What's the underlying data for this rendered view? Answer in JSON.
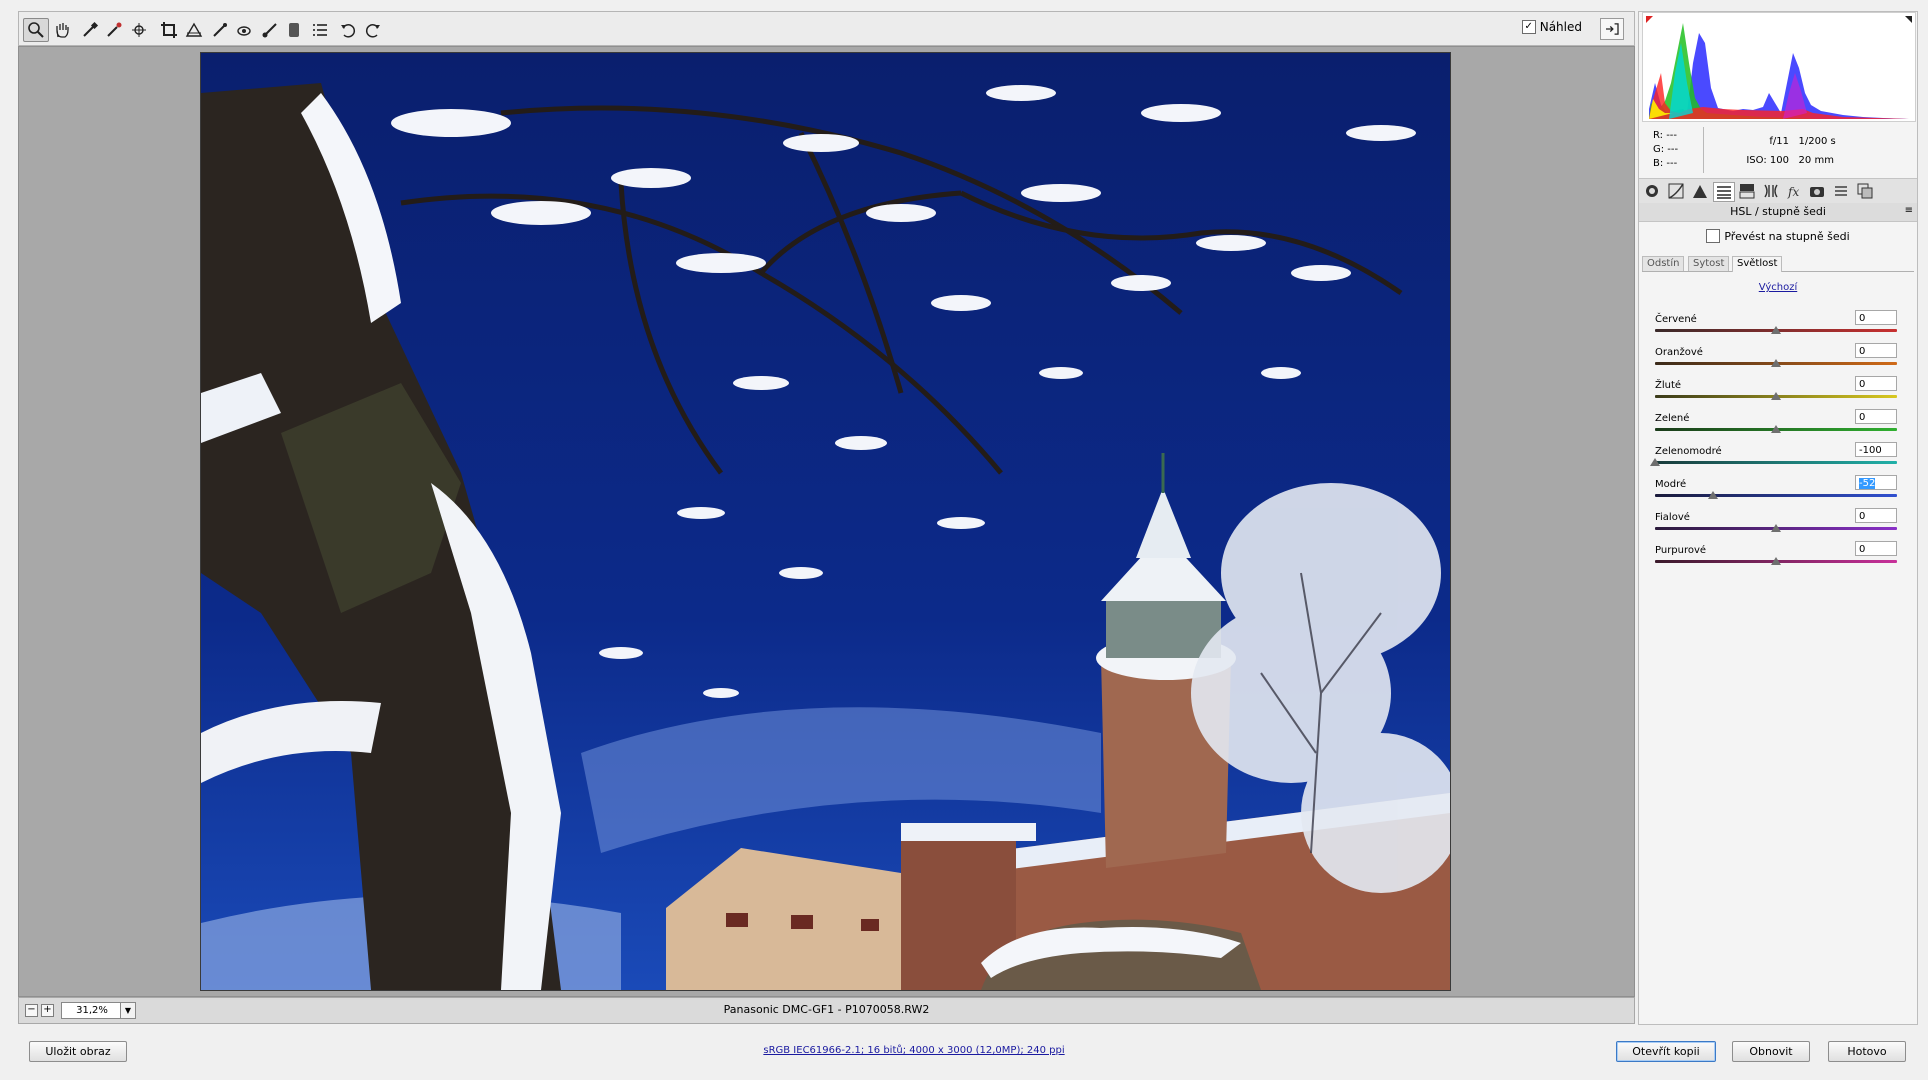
{
  "toolbar": {
    "tools": [
      {
        "name": "zoom-tool",
        "icon": "magnifier-icon"
      },
      {
        "name": "hand-tool",
        "icon": "hand-icon"
      },
      {
        "name": "white-balance-tool",
        "icon": "eyedropper-icon"
      },
      {
        "name": "color-sampler-tool",
        "icon": "color-sampler-icon"
      },
      {
        "name": "targeted-adjustment-tool",
        "icon": "target-adjust-icon"
      },
      {
        "name": "crop-tool",
        "icon": "crop-icon"
      },
      {
        "name": "straighten-tool",
        "icon": "straighten-icon"
      },
      {
        "name": "spot-removal-tool",
        "icon": "spot-removal-icon"
      },
      {
        "name": "red-eye-tool",
        "icon": "red-eye-icon"
      },
      {
        "name": "adjustment-brush-tool",
        "icon": "brush-icon"
      },
      {
        "name": "graduated-filter-tool",
        "icon": "graduated-filter-icon"
      },
      {
        "name": "preferences-tool",
        "icon": "list-icon"
      },
      {
        "name": "rotate-left-tool",
        "icon": "rotate-ccw-icon"
      },
      {
        "name": "rotate-right-tool",
        "icon": "rotate-cw-icon"
      }
    ],
    "preview_label": "Náhled",
    "preview_checked": "✓"
  },
  "status": {
    "zoom_minus": "−",
    "zoom_plus": "+",
    "zoom_value": "31,2%",
    "camera_info": "Panasonic DMC-GF1  -  P1070058.RW2"
  },
  "readout": {
    "r": "R:   ---",
    "g": "G:   ---",
    "b": "B:   ---",
    "aperture": "f/11",
    "shutter": "1/200 s",
    "iso": "ISO: 100",
    "focal": "20 mm"
  },
  "panel": {
    "title": "HSL / stupně šedi",
    "menu": "≡",
    "grayscale_label": "Převést na stupně šedi",
    "subtabs": [
      "Odstín",
      "Sytost",
      "Světlost"
    ],
    "default_link": "Výchozí",
    "sliders": [
      {
        "label": "Červené",
        "value": "0",
        "pos": 0.5,
        "gradient": "linear-gradient(90deg,#3a2a2a,#c83030)"
      },
      {
        "label": "Oranžové",
        "value": "0",
        "pos": 0.5,
        "gradient": "linear-gradient(90deg,#3a2a1a,#d06a18)"
      },
      {
        "label": "Žluté",
        "value": "0",
        "pos": 0.5,
        "gradient": "linear-gradient(90deg,#3a3a1a,#d8c820)"
      },
      {
        "label": "Zelené",
        "value": "0",
        "pos": 0.5,
        "gradient": "linear-gradient(90deg,#1a3a1a,#30b030)"
      },
      {
        "label": "Zelenomodré",
        "value": "-100",
        "pos": 0.0,
        "gradient": "linear-gradient(90deg,#1a3a3a,#20b0a8)"
      },
      {
        "label": "Modré",
        "value": "-52",
        "pos": 0.24,
        "gradient": "linear-gradient(90deg,#1a1a3a,#3050d0)"
      },
      {
        "label": "Fialové",
        "value": "0",
        "pos": 0.5,
        "gradient": "linear-gradient(90deg,#2a1a3a,#8a30c8)"
      },
      {
        "label": "Purpurové",
        "value": "0",
        "pos": 0.5,
        "gradient": "linear-gradient(90deg,#3a1a2a,#c8309a)"
      }
    ]
  },
  "bottom": {
    "save_label": "Uložit obraz",
    "workflow": "sRGB IEC61966-2.1; 16 bitů; 4000 x 3000 (12,0MP); 240 ppi",
    "open_copy": "Otevřít kopii",
    "reset": "Obnovit",
    "done": "Hotovo"
  }
}
